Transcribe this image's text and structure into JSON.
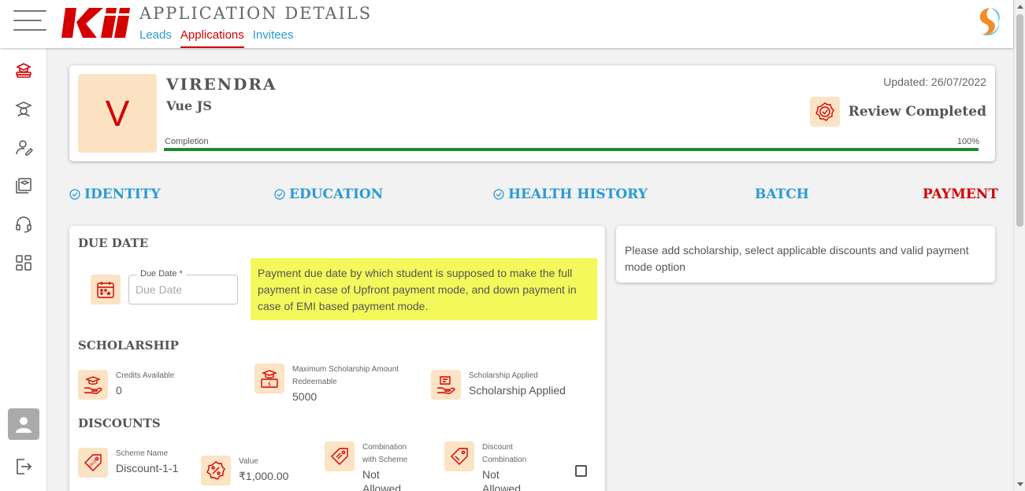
{
  "header": {
    "title": "APPLICATION DETAILS",
    "tabs": [
      {
        "label": "Leads",
        "active": false
      },
      {
        "label": "Applications",
        "active": true
      },
      {
        "label": "Invitees",
        "active": false
      }
    ],
    "logo_text": "KII"
  },
  "sidebar": {
    "items": [
      {
        "icon": "graduation-stack-icon",
        "active": true
      },
      {
        "icon": "student-cap-icon",
        "active": false
      },
      {
        "icon": "user-edit-icon",
        "active": false
      },
      {
        "icon": "courses-icon",
        "active": false
      },
      {
        "icon": "headset-icon",
        "active": false
      },
      {
        "icon": "dashboard-grid-icon",
        "active": false
      }
    ],
    "bottom": [
      "avatar-icon",
      "logout-icon"
    ]
  },
  "profile": {
    "initial": "V",
    "name": "VIRENDRA",
    "course": "Vue JS",
    "updated": "Updated: 26/07/2022",
    "status": "Review Completed",
    "completion_label": "Completion",
    "completion_percent_text": "100%",
    "completion_fraction": 1.0
  },
  "steps": [
    {
      "label": "IDENTITY",
      "checked": true,
      "active": false
    },
    {
      "label": "EDUCATION",
      "checked": true,
      "active": false
    },
    {
      "label": "HEALTH HISTORY",
      "checked": true,
      "active": false
    },
    {
      "label": "BATCH",
      "checked": false,
      "active": false
    },
    {
      "label": "PAYMENT",
      "checked": false,
      "active": true
    }
  ],
  "due_date": {
    "title": "DUE DATE",
    "field_label": "Due Date *",
    "placeholder": "Due Date",
    "value": "",
    "note": "Payment due date by which student is supposed to make the full payment in case of Upfront payment mode, and down payment in case of EMI based payment mode."
  },
  "scholarship": {
    "title": "SCHOLARSHIP",
    "items": [
      {
        "label": "Credits Available",
        "value": "0"
      },
      {
        "label": "Maximum Scholarship Amount Redeemable",
        "value": "5000"
      },
      {
        "label": "Scholarship Applied",
        "value": "Scholarship Applied"
      }
    ]
  },
  "discounts": {
    "title": "DISCOUNTS",
    "items": [
      {
        "label": "Scheme Name",
        "value": "Discount-1-1"
      },
      {
        "label": "Value",
        "value": "₹1,000.00"
      },
      {
        "label": "Combination with Scheme",
        "value": "Not Allowed"
      },
      {
        "label": "Discount Combination",
        "value": "Not Allowed"
      }
    ],
    "selected": false
  },
  "right_panel": {
    "message": "Please add scholarship, select applicable discounts and valid payment mode option"
  },
  "colors": {
    "accent_red": "#d40000",
    "link_blue": "#2a9ad6",
    "icon_bg": "#fbe3c4",
    "note_bg": "#f3f95a",
    "progress_green": "#1e8a2f"
  }
}
